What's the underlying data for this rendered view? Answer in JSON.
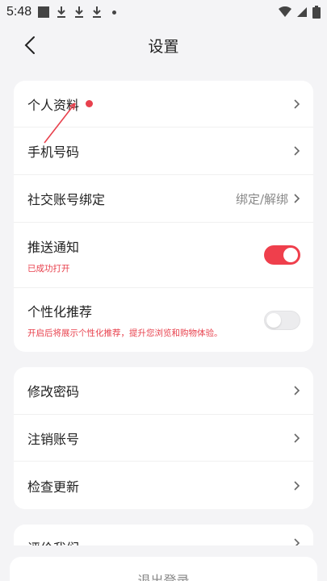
{
  "status_bar": {
    "time": "5:48"
  },
  "header": {
    "title": "设置"
  },
  "card1": {
    "items": [
      {
        "label": "个人资料"
      },
      {
        "label": "手机号码"
      },
      {
        "label": "社交账号绑定",
        "value": "绑定/解绑"
      },
      {
        "label": "推送通知",
        "sub": "已成功打开",
        "toggle": "on"
      },
      {
        "label": "个性化推荐",
        "sub": "开启后将展示个性化推荐，提升您浏览和购物体验。",
        "toggle": "off"
      }
    ]
  },
  "card2": {
    "items": [
      {
        "label": "修改密码"
      },
      {
        "label": "注销账号"
      },
      {
        "label": "检查更新"
      }
    ]
  },
  "card3": {
    "items": [
      {
        "label": "评价我们"
      }
    ]
  },
  "footer": {
    "logout_label": "退出登录"
  },
  "colors": {
    "accent": "#ef3f4c",
    "sub_text": "#e8414d",
    "background": "#f4f4f6"
  }
}
